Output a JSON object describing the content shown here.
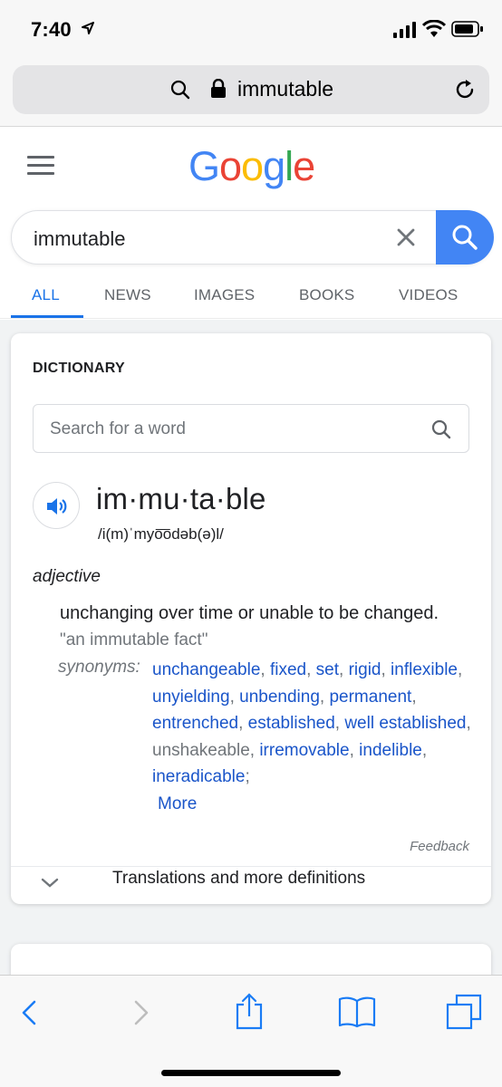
{
  "status_bar": {
    "time": "7:40"
  },
  "browser": {
    "url_text": "immutable"
  },
  "google": {
    "logo_letters": [
      {
        "ch": "G",
        "color": "#4285f4"
      },
      {
        "ch": "o",
        "color": "#ea4335"
      },
      {
        "ch": "o",
        "color": "#fbbc05"
      },
      {
        "ch": "g",
        "color": "#4285f4"
      },
      {
        "ch": "l",
        "color": "#34a853"
      },
      {
        "ch": "e",
        "color": "#ea4335"
      }
    ],
    "query": "immutable",
    "tabs": [
      "ALL",
      "NEWS",
      "IMAGES",
      "BOOKS",
      "VIDEOS"
    ],
    "active_tab": "ALL"
  },
  "dictionary": {
    "heading": "DICTIONARY",
    "search_placeholder": "Search for a word",
    "word": "im·mu·ta·ble",
    "phonetic": "/i(m)ˈmyo͞odəb(ə)l/",
    "part_of_speech": "adjective",
    "definition": "unchanging over time or unable to be changed.",
    "example": "\"an immutable fact\"",
    "synonyms_label": "synonyms:",
    "synonyms": [
      {
        "word": "unchangeable",
        "link": true
      },
      {
        "word": "fixed",
        "link": true
      },
      {
        "word": "set",
        "link": true
      },
      {
        "word": "rigid",
        "link": true
      },
      {
        "word": "inflexible",
        "link": true
      },
      {
        "word": "unyielding",
        "link": true
      },
      {
        "word": "unbending",
        "link": true
      },
      {
        "word": "permanent",
        "link": true
      },
      {
        "word": "entrenched",
        "link": true
      },
      {
        "word": "established",
        "link": true
      },
      {
        "word": "well established",
        "link": true
      },
      {
        "word": "unshakeable",
        "link": false
      },
      {
        "word": "irremovable",
        "link": true
      },
      {
        "word": "indelible",
        "link": true
      },
      {
        "word": "ineradicable",
        "link": true
      }
    ],
    "more_label": "More",
    "feedback_label": "Feedback",
    "translations_label": "Translations and more definitions"
  },
  "colors": {
    "accent": "#1a73e8",
    "search_button": "#4285f4",
    "link": "#1a55c9"
  },
  "icons": [
    "location-arrow-icon",
    "signal-icon",
    "wifi-icon",
    "battery-icon",
    "search-icon",
    "lock-icon",
    "reload-icon",
    "menu-icon",
    "clear-icon",
    "speaker-icon",
    "chevron-down-icon",
    "back-icon",
    "forward-icon",
    "share-icon",
    "bookmarks-icon",
    "tabs-icon"
  ]
}
